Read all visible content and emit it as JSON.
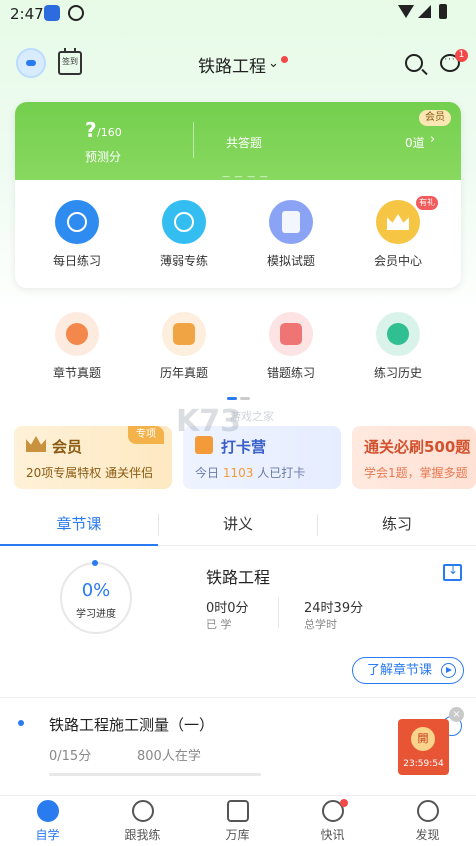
{
  "status_bar": {
    "time": "2:47"
  },
  "header": {
    "signin_label": "签到",
    "exam_selector": "铁路工程",
    "message_badge": "1"
  },
  "score_card": {
    "predicted_score": "?",
    "max_score": "/160",
    "predicted_label": "预测分",
    "answered_label": "共答题",
    "answered_value": "0道",
    "vip_tag": "会员",
    "features": [
      {
        "label": "每日练习",
        "icon": "clock-icon"
      },
      {
        "label": "薄弱专练",
        "icon": "chat-face-icon"
      },
      {
        "label": "模拟试题",
        "icon": "exam-paper-icon"
      },
      {
        "label": "会员中心",
        "icon": "crown-icon"
      }
    ],
    "gift_tag": "有礼"
  },
  "secondary_features": [
    {
      "label": "章节真题",
      "icon": "gear-bulb-icon"
    },
    {
      "label": "历年真题",
      "icon": "book-icon"
    },
    {
      "label": "错题练习",
      "icon": "wrong-note-icon"
    },
    {
      "label": "练习历史",
      "icon": "history-clock-icon"
    }
  ],
  "watermark": {
    "logo": "K73",
    "sub": "游戏之家"
  },
  "banners": {
    "vip": {
      "title": "会员",
      "tag": "专项",
      "subtitle": "20项专属特权  通关伴侣"
    },
    "checkin": {
      "title": "打卡营",
      "sub_prefix": "今日",
      "sub_count": "1103",
      "sub_suffix": "人已打卡"
    },
    "must": {
      "title": "通关必刷500题",
      "subtitle": "学会1题，掌握多题"
    }
  },
  "tabs": [
    "章节课",
    "讲义",
    "练习"
  ],
  "course": {
    "progress_pct": "0%",
    "progress_label": "学习进度",
    "title": "铁路工程",
    "learned_value": "0时0分",
    "learned_label": "已 学",
    "total_value": "24时39分",
    "total_label": "总学时",
    "learn_more": "了解章节课"
  },
  "chapter": {
    "title": "铁路工程施工测量（一）",
    "score": "0/15分",
    "learners": "800人在学"
  },
  "promo": {
    "label": "開",
    "countdown": "23:59:54"
  },
  "bottom_nav": [
    "自学",
    "跟我练",
    "万库",
    "快讯",
    "发现"
  ],
  "colors": {
    "accent": "#2b7bf0",
    "green": "#74cf4e",
    "red": "#f24848"
  }
}
